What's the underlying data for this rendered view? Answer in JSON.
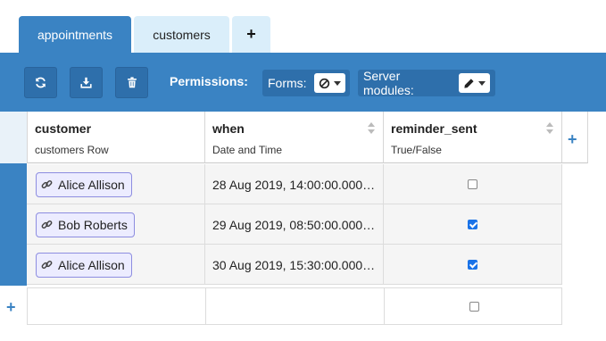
{
  "tabs": [
    {
      "label": "appointments",
      "active": true
    },
    {
      "label": "customers",
      "active": false
    },
    {
      "label": "+",
      "active": false
    }
  ],
  "toolbar": {
    "refresh_icon": "refresh-icon",
    "download_icon": "download-icon",
    "delete_icon": "trash-icon",
    "permissions_label": "Permissions:",
    "forms_label": "Forms:",
    "forms_value_icon": "ban-icon",
    "server_modules_label": "Server modules:",
    "server_modules_value_icon": "pencil-icon"
  },
  "columns": [
    {
      "name": "customer",
      "type": "customers Row"
    },
    {
      "name": "when",
      "type": "Date and Time"
    },
    {
      "name": "reminder_sent",
      "type": "True/False"
    }
  ],
  "add_column_label": "+",
  "add_row_label": "+",
  "rows": [
    {
      "customer": "Alice Allison",
      "when": "28 Aug 2019, 14:00:00.000…",
      "reminder_sent": false
    },
    {
      "customer": "Bob Roberts",
      "when": "29 Aug 2019, 08:50:00.000…",
      "reminder_sent": true
    },
    {
      "customer": "Alice Allison",
      "when": "30 Aug 2019, 15:30:00.000…",
      "reminder_sent": true
    }
  ],
  "colors": {
    "accent": "#3a83c3",
    "tab_inactive": "#daeefa",
    "chip_border": "#8d8de0",
    "checkbox_checked": "#1a73e8"
  }
}
